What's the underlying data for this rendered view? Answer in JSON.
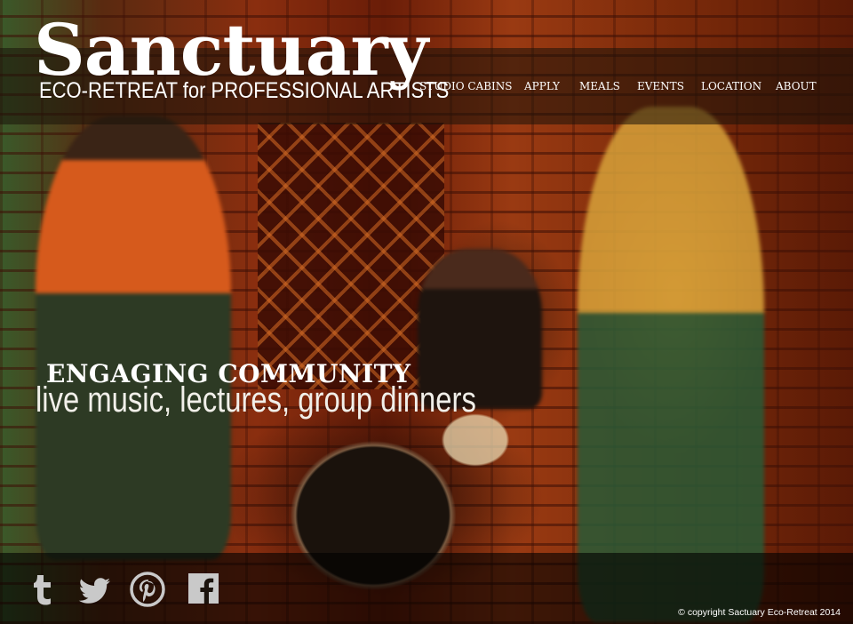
{
  "brand": {
    "title": "Sanctuary",
    "tagline": "ECO-RETREAT for PROFESSIONAL ARTISTS"
  },
  "nav": {
    "items": [
      {
        "label": "STUDIO CABINS"
      },
      {
        "label": "APPLY"
      },
      {
        "label": "MEALS"
      },
      {
        "label": "EVENTS"
      },
      {
        "label": "LOCATION"
      },
      {
        "label": "ABOUT"
      }
    ]
  },
  "hero": {
    "heading": "ENGAGING COMMUNITY",
    "subheading": "live music, lectures, group dinners"
  },
  "footer": {
    "social": [
      {
        "name": "tumblr",
        "icon": "tumblr-icon"
      },
      {
        "name": "twitter",
        "icon": "twitter-icon"
      },
      {
        "name": "pinterest",
        "icon": "pinterest-icon"
      },
      {
        "name": "facebook",
        "icon": "facebook-icon"
      }
    ],
    "copyright": "© copyright Sactuary Eco-Retreat 2014"
  },
  "colors": {
    "text": "#ffffff",
    "icon": "#c9c9c9",
    "header_overlay": "#19120a",
    "footer_overlay": "#000000"
  }
}
